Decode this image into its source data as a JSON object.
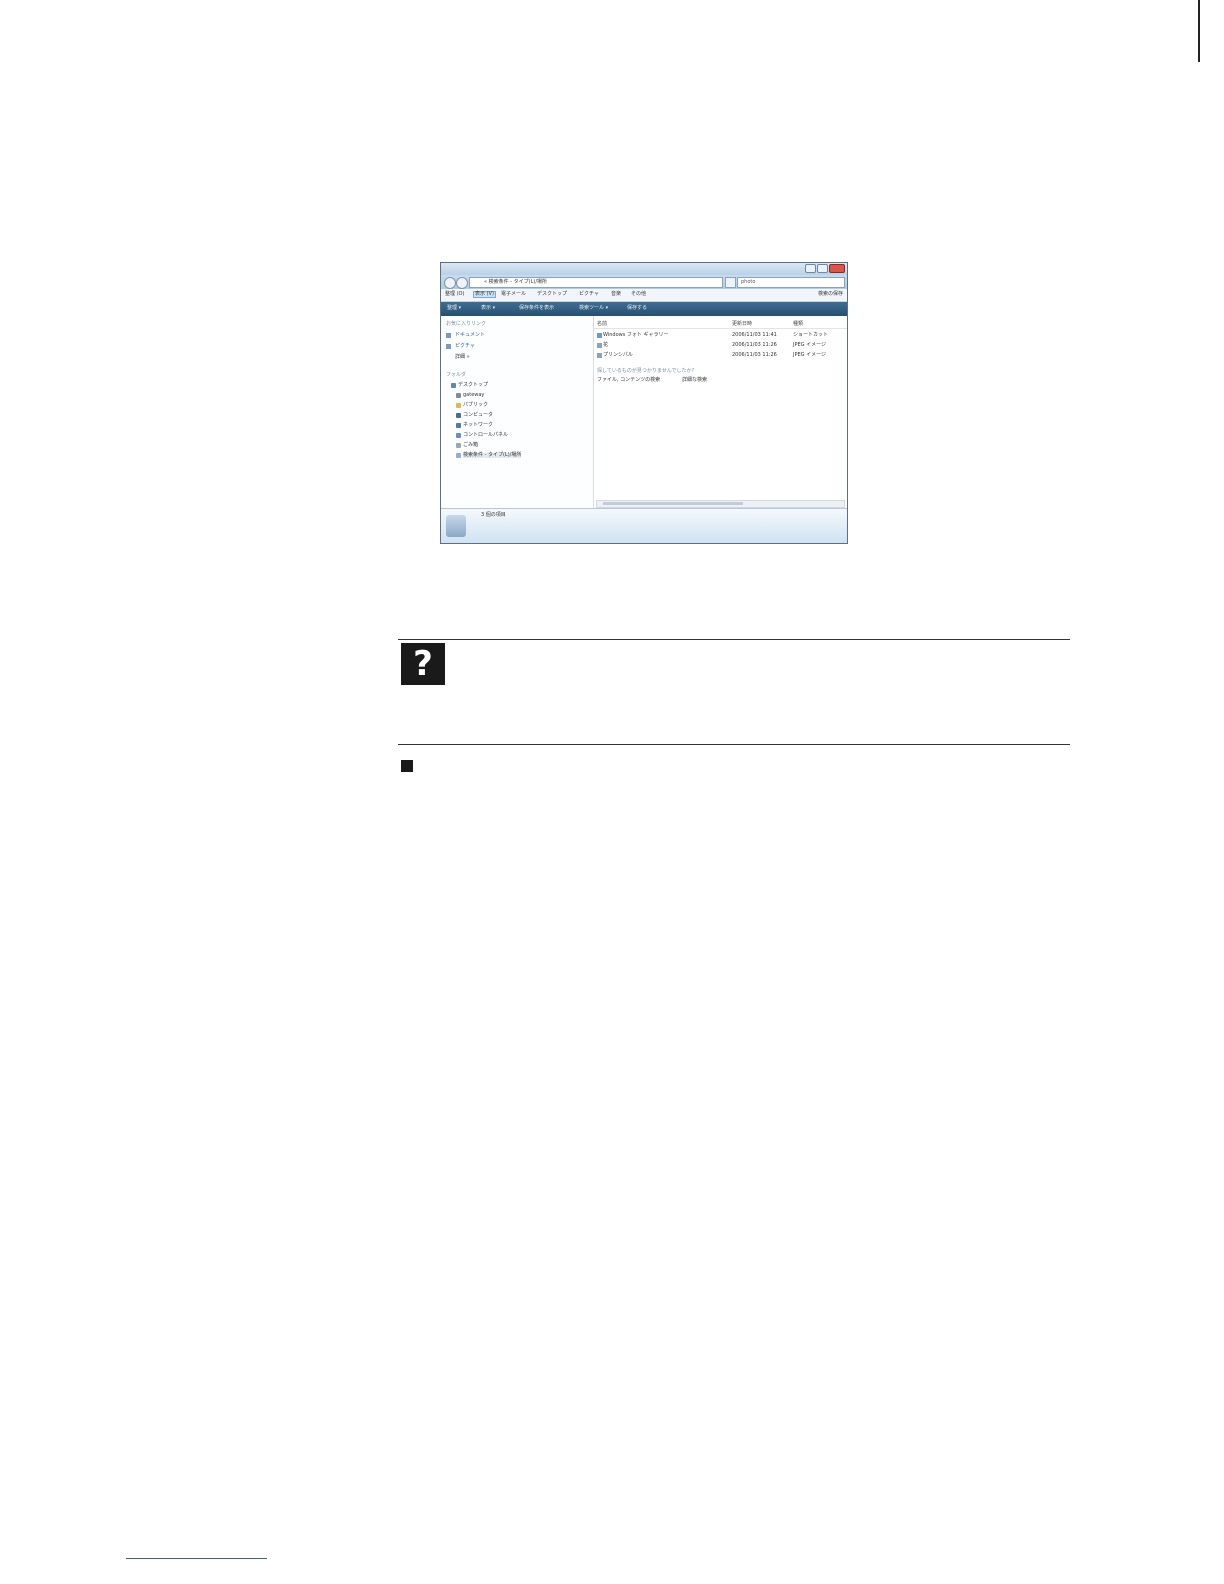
{
  "screenshot": {
    "address": "« 検索条件 - タイプ(L)/場所",
    "search": "photo",
    "menus": [
      "整理 (O)",
      "表示 (V)",
      "電子メール",
      "デスクトップ",
      "ピクチャ",
      "音楽",
      "その他"
    ],
    "menu_right": "検索の保存",
    "commands": [
      "整理 ▾",
      "表示 ▾",
      "保存条件を表示",
      "検索ツール ▾",
      "保存する"
    ],
    "left_pane": {
      "favorites_header": "お気に入りリンク",
      "favorites": [
        "ドキュメント",
        "ピクチャ",
        "詳細 »"
      ],
      "folders_header": "フォルダ",
      "tree": [
        "デスクトップ",
        "gateway",
        "パブリック",
        "コンピュータ",
        "ネットワーク",
        "コントロールパネル",
        "ごみ箱",
        "検索条件 - タイプ(L)/場所"
      ]
    },
    "columns": [
      "名前",
      "更新日時",
      "種類"
    ],
    "rows": [
      {
        "name": "Windows フォト ギャラリー",
        "date": "2006/11/03 11:41",
        "type": "ショートカット"
      },
      {
        "name": "花",
        "date": "2006/11/03 11:26",
        "type": "JPEG イメージ"
      },
      {
        "name": "プリンシパル",
        "date": "2006/11/03 11:26",
        "type": "JPEG イメージ"
      }
    ],
    "hint": "探しているものが見つかりませんでしたか?",
    "search_buttons": [
      "ファイル, コンテンツの検索",
      "詳細な検索"
    ],
    "details": "3 個の項目"
  },
  "help_icon": "?"
}
